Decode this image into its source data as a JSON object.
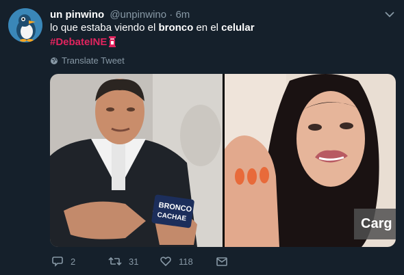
{
  "user": {
    "display_name": "un pinwino",
    "handle": "@unpinwino",
    "separator": "·",
    "time": "6m"
  },
  "tweet": {
    "text_part1": "lo que estaba viendo el ",
    "text_bold1": "bronco",
    "text_part2": " en el ",
    "text_bold2": "celular",
    "hashtag": "#DebateINE"
  },
  "translate_label": "Translate Tweet",
  "media": {
    "left_card_text_line1": "BRONCO",
    "left_card_text_line2": "CACHAE",
    "right_overlay_text": "Carg"
  },
  "actions": {
    "reply_count": "2",
    "retweet_count": "31",
    "like_count": "118"
  },
  "colors": {
    "background": "#15202b",
    "secondary_text": "#8899a6",
    "hashtag": "#e0245e"
  }
}
